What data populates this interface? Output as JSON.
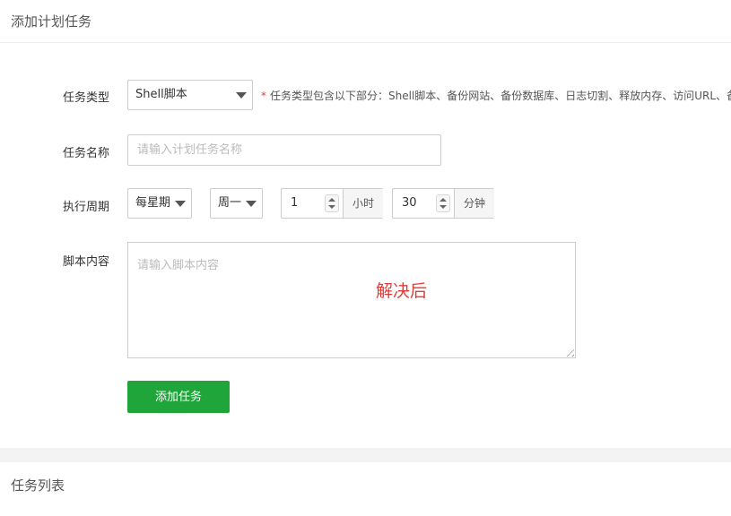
{
  "add_panel": {
    "title": "添加计划任务",
    "form": {
      "task_type": {
        "label": "任务类型",
        "selected": "Shell脚本",
        "hint_star": "*",
        "hint": "任务类型包含以下部分：Shell脚本、备份网站、备份数据库、日志切割、释放内存、访问URL、备"
      },
      "task_name": {
        "label": "任务名称",
        "placeholder": "请输入计划任务名称",
        "value": ""
      },
      "cycle": {
        "label": "执行周期",
        "period_selected": "每星期",
        "weekday_selected": "周一",
        "hour_value": "1",
        "hour_unit": "小时",
        "minute_value": "30",
        "minute_unit": "分钟"
      },
      "script": {
        "label": "脚本内容",
        "placeholder": "请输入脚本内容"
      },
      "annotation": "解决后",
      "submit_label": "添加任务"
    }
  },
  "list_panel": {
    "title": "任务列表"
  },
  "colors": {
    "primary_green": "#20a53a",
    "annotation_red": "#e53935",
    "required_star": "#e0403f"
  }
}
